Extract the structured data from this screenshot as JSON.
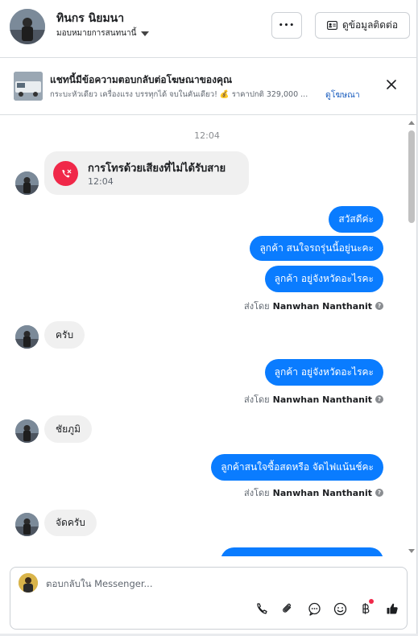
{
  "header": {
    "contact_name": "ทินกร นิยมนา",
    "assign_label": "มอบหมายการสนทนานี้",
    "more_label": "•••",
    "contact_info_label": "ดูข้อมูลติดต่อ"
  },
  "ad": {
    "title": "แชทนี้มีข้อความตอบกลับต่อโฆษณาของคุณ",
    "description": "กระบะหัวเดียว เครื่องแรง บรรทุกได้ จบในคันเดียว! 💰 ราคาปกติ 329,000 ...",
    "link_label": "ดูโฆษณา"
  },
  "thread": {
    "timestamp": "12:04",
    "missed_call": {
      "title": "การโทรด้วยเสียงที่ไม่ได้รับสาย",
      "time": "12:04"
    },
    "sent_by_prefix": "ส่งโดย",
    "sent_by_name": "Nanwhan Nanthanit",
    "messages": [
      {
        "dir": "out",
        "text": "สวัสดีค่ะ"
      },
      {
        "dir": "out",
        "text": "ลูกค้า  สนใจรถรุ่นนี้อยู่นะคะ"
      },
      {
        "dir": "out",
        "text": "ลูกค้า อยู่จังหวัดอะไรคะ"
      },
      {
        "dir": "in",
        "text": "ครับ"
      },
      {
        "dir": "out",
        "text": "ลูกค้า อยู่จังหวัดอะไรคะ"
      },
      {
        "dir": "in",
        "text": "ชัยภูมิ"
      },
      {
        "dir": "out",
        "text": "ลูกค้าสนใจซื้อสดหรือ จัดไฟแน้นช์คะ"
      },
      {
        "dir": "in",
        "text": "จัดครับ"
      }
    ]
  },
  "composer": {
    "placeholder": "ตอบกลับใน Messenger...",
    "tools": [
      "phone-icon",
      "paperclip-icon",
      "chat-bubble-icon",
      "smiley-icon",
      "baht-icon",
      "thumbs-up-icon"
    ]
  },
  "colors": {
    "accent": "#0a7cff",
    "missed_call": "#f02849",
    "incoming_bubble": "#f0f0f0"
  }
}
